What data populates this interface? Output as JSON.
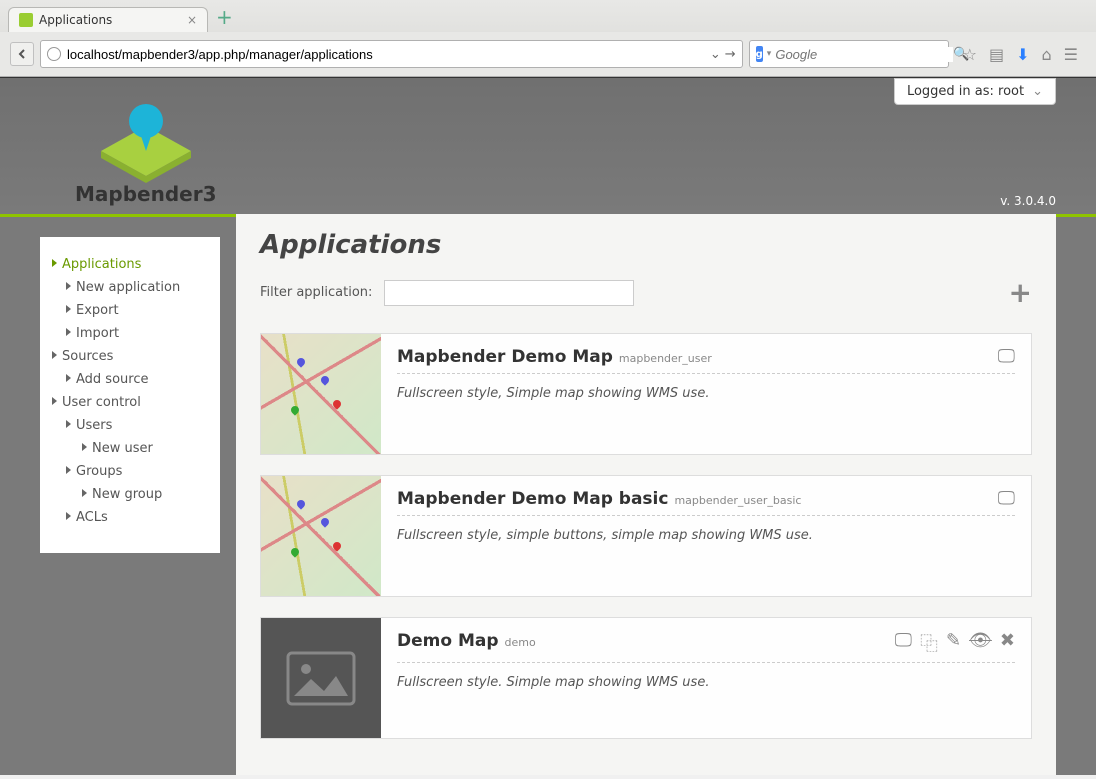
{
  "browser": {
    "tab_title": "Applications",
    "url": "localhost/mapbender3/app.php/manager/applications",
    "search_placeholder": "Google"
  },
  "header": {
    "logged_in": "Logged in as: root",
    "brand": "Mapbender3",
    "version": "v. 3.0.4.0"
  },
  "sidebar": [
    {
      "label": "Applications",
      "level": 0,
      "active": true
    },
    {
      "label": "New application",
      "level": 1
    },
    {
      "label": "Export",
      "level": 1
    },
    {
      "label": "Import",
      "level": 1
    },
    {
      "label": "Sources",
      "level": 0
    },
    {
      "label": "Add source",
      "level": 1
    },
    {
      "label": "User control",
      "level": 0
    },
    {
      "label": "Users",
      "level": 1
    },
    {
      "label": "New user",
      "level": 2
    },
    {
      "label": "Groups",
      "level": 1
    },
    {
      "label": "New group",
      "level": 2
    },
    {
      "label": "ACLs",
      "level": 1
    }
  ],
  "main": {
    "heading": "Applications",
    "filter_label": "Filter application:",
    "filter_value": "",
    "apps": [
      {
        "title": "Mapbender Demo Map",
        "slug": "mapbender_user",
        "desc": "Fullscreen style, Simple map showing WMS use.",
        "thumb": "map",
        "actions": [
          "view"
        ]
      },
      {
        "title": "Mapbender Demo Map basic",
        "slug": "mapbender_user_basic",
        "desc": "Fullscreen style, simple buttons, simple map showing WMS use.",
        "thumb": "map",
        "actions": [
          "view"
        ]
      },
      {
        "title": "Demo Map",
        "slug": "demo",
        "desc": "Fullscreen style. Simple map showing WMS use.",
        "thumb": "placeholder",
        "actions": [
          "view",
          "copy",
          "edit",
          "publish",
          "delete"
        ]
      }
    ]
  },
  "icons": {
    "view": "🖵",
    "copy": "⿻",
    "edit": "✎",
    "publish": "👁",
    "delete": "✖"
  }
}
